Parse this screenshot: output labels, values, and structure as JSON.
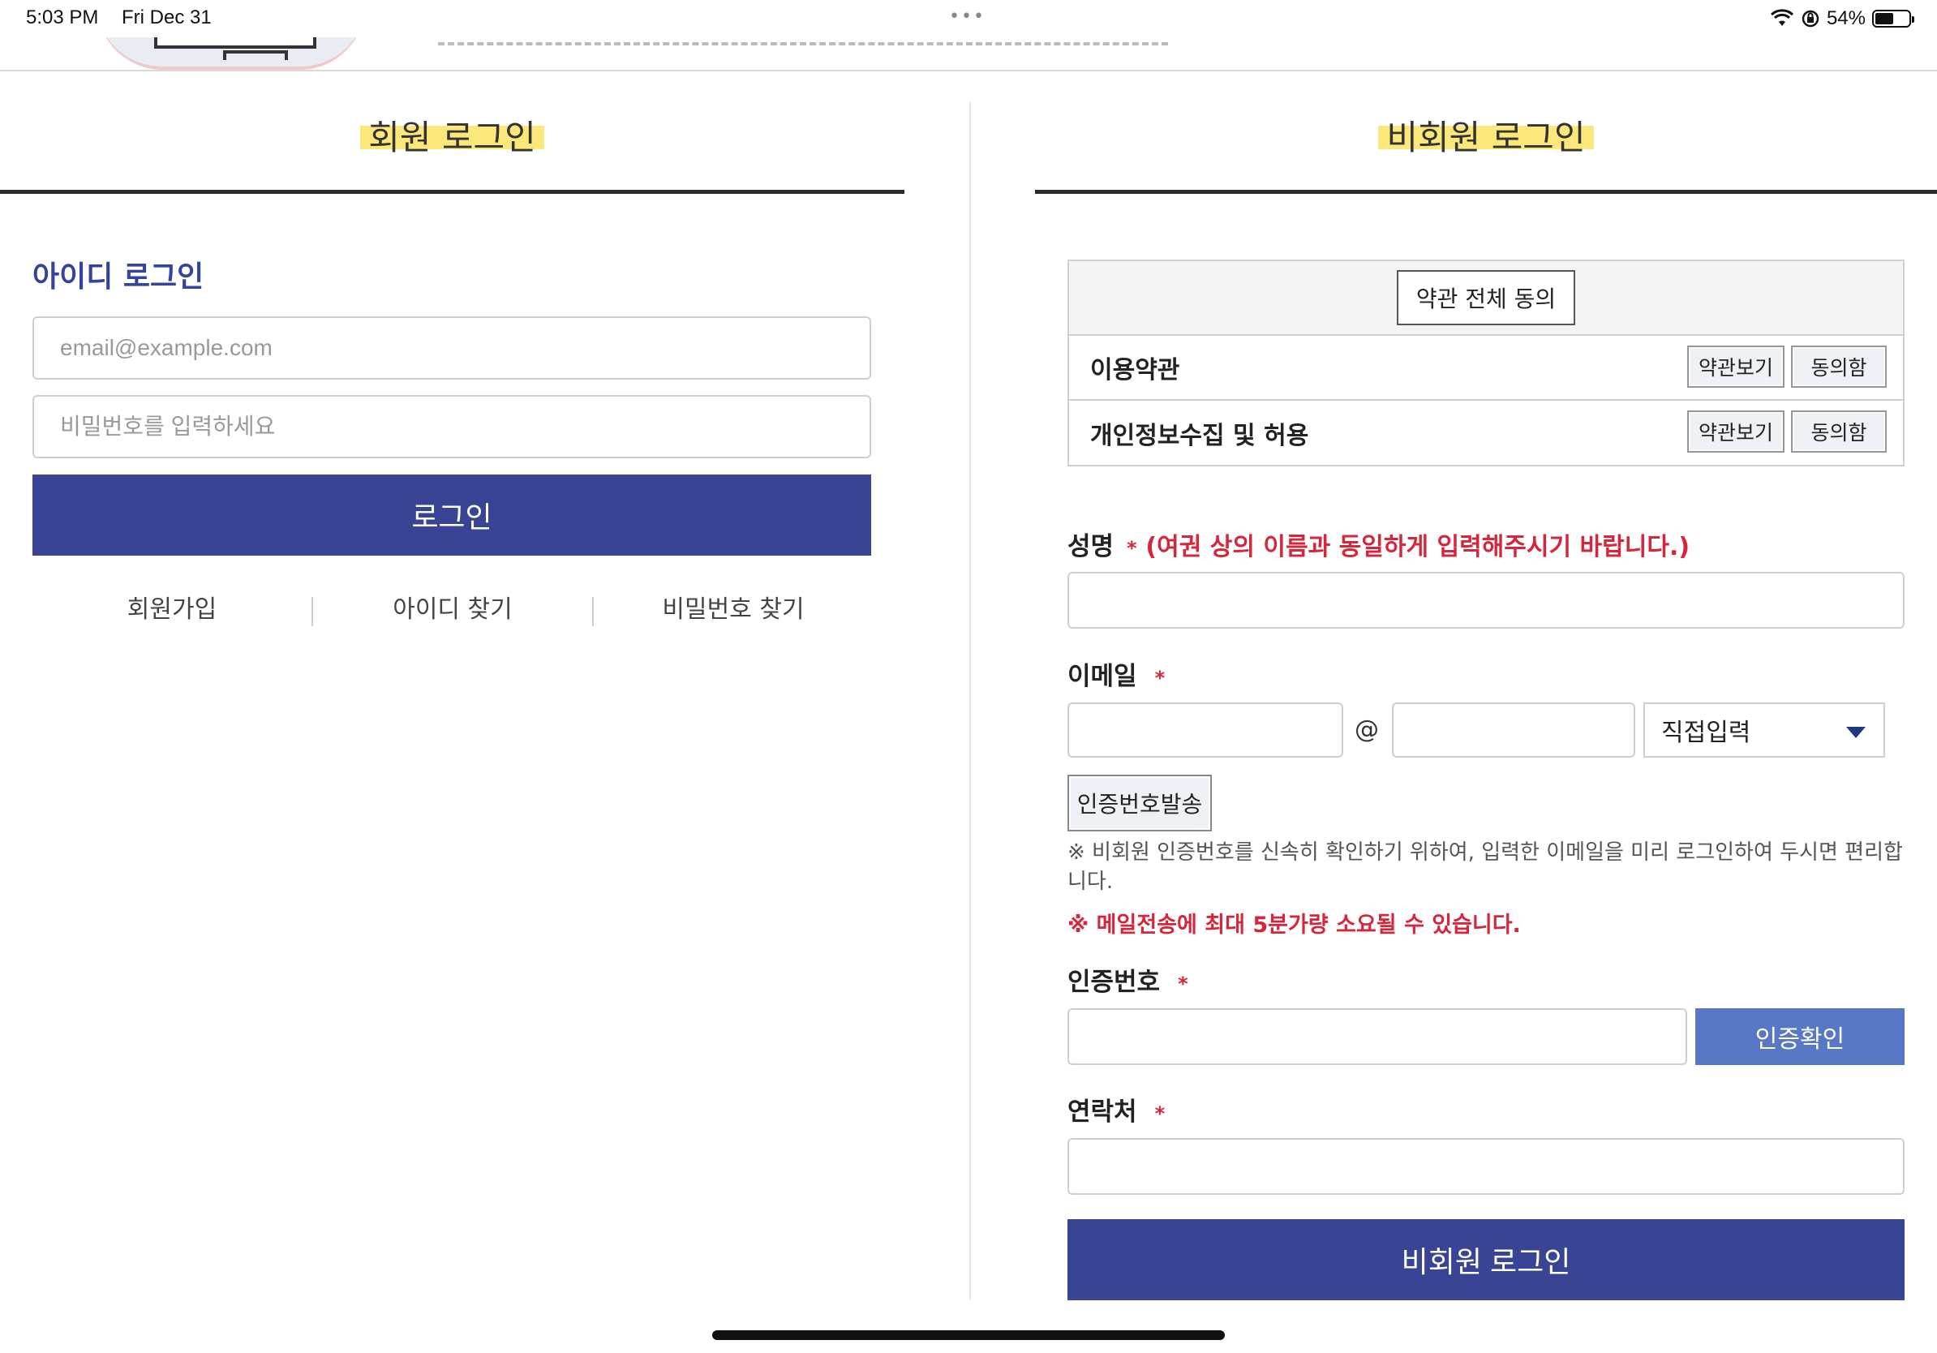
{
  "status_bar": {
    "time": "5:03 PM",
    "date": "Fri Dec 31",
    "dots": "•••",
    "battery_pct": "54%",
    "battery_level": 0.54,
    "icons": [
      "wifi-icon",
      "orientation-lock-icon",
      "battery-icon"
    ]
  },
  "member": {
    "title": "회원 로그인",
    "id_login_title": "아이디 로그인",
    "email_placeholder": "email@example.com",
    "password_placeholder": "비밀번호를 입력하세요",
    "login_label": "로그인",
    "links": {
      "signup": "회원가입",
      "find_id": "아이디 찾기",
      "find_password": "비밀번호 찾기"
    }
  },
  "guest": {
    "title": "비회원 로그인",
    "agree_all_label": "약관 전체 동의",
    "terms": [
      {
        "label": "이용약관",
        "view": "약관보기",
        "agree": "동의함"
      },
      {
        "label": "개인정보수집 및 허용",
        "view": "약관보기",
        "agree": "동의함"
      }
    ],
    "name": {
      "label": "성명",
      "req": "*",
      "note": "(여권 상의 이름과 동일하게 입력해주시기 바랍니다.)"
    },
    "email": {
      "label": "이메일",
      "req": "*",
      "at": "@",
      "domain_select": "직접입력",
      "send_code_label": "인증번호발송",
      "note": "※ 비회원 인증번호를 신속히 확인하기 위하여, 입력한 이메일을 미리 로그인하여 두시면 편리합니다.",
      "warning": "※ 메일전송에 최대 5분가량 소요될 수 있습니다."
    },
    "code": {
      "label": "인증번호",
      "req": "*",
      "verify_label": "인증확인"
    },
    "phone": {
      "label": "연락처",
      "req": "*"
    },
    "submit_label": "비회원 로그인"
  },
  "colors": {
    "primary": "#394594",
    "verify": "#5877c4",
    "required": "#d6263b",
    "highlight": "#fbe77a",
    "link_title": "#33449a"
  }
}
